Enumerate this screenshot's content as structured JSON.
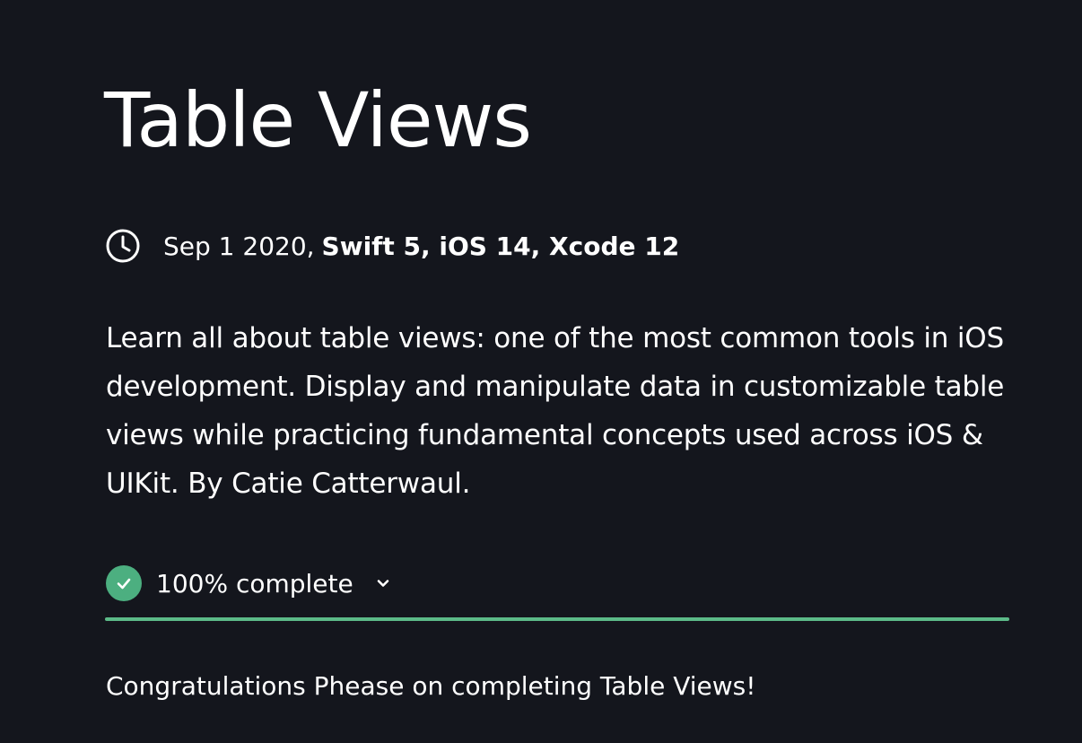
{
  "course": {
    "title": "Table Views",
    "date": "Sep 1 2020,",
    "tech": "Swift 5, iOS 14, Xcode 12",
    "description": "Learn all about table views: one of the most common tools in iOS development. Display and manipulate data in customizable table views while practicing fundamental concepts used across iOS & UIKit. By Catie Catterwaul."
  },
  "progress": {
    "label": "100% complete",
    "fraction": 1.0,
    "congrats": "Congratulations Phease on completing Table Views!"
  },
  "icons": {
    "meta": "clock-icon",
    "status": "checkmark-icon",
    "toggle": "chevron-down-icon"
  },
  "colors": {
    "background": "#14161d",
    "accent": "#5cba88",
    "check": "#4caf80"
  }
}
